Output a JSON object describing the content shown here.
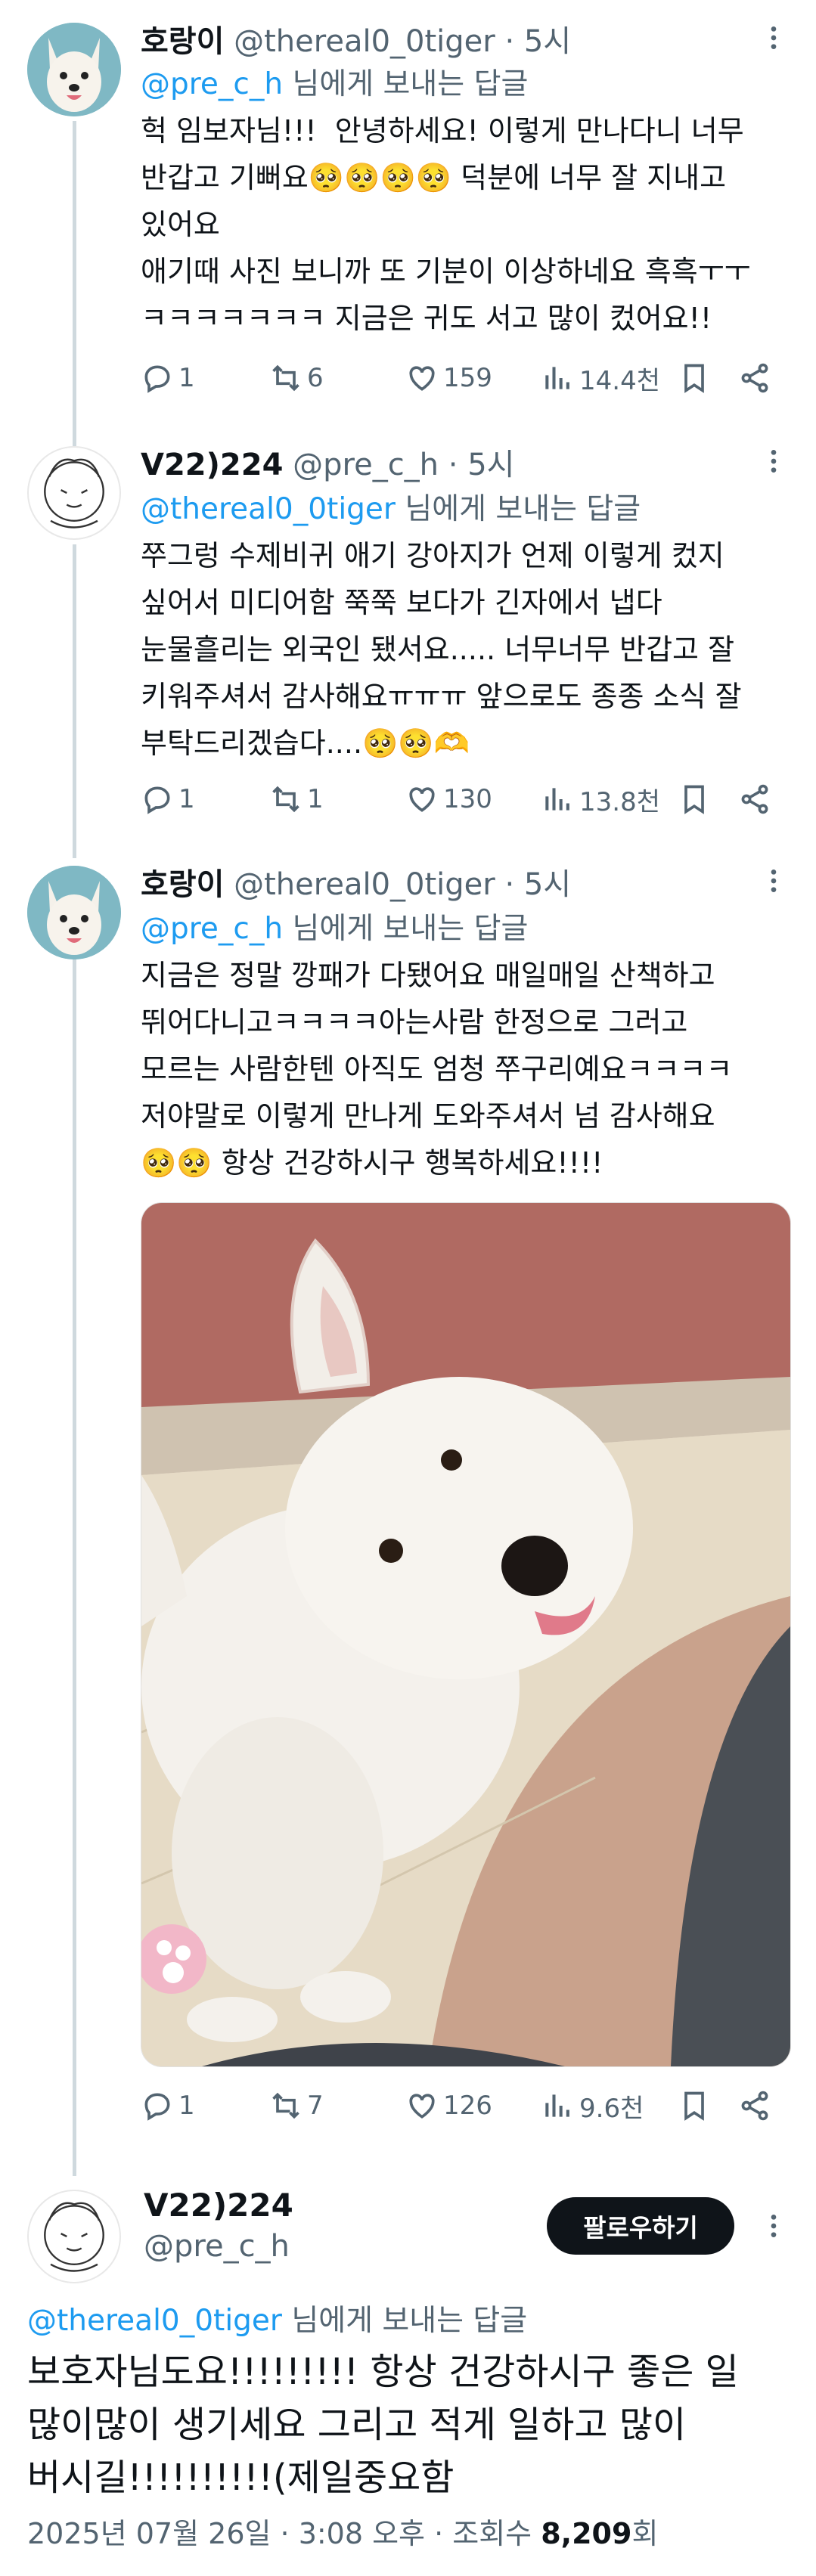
{
  "tweets": [
    {
      "name": "호랑이",
      "handle": "@thereal0_0tiger",
      "time": "· 5시",
      "reply_mention": "@pre_c_h",
      "reply_suffix": " 님에게 보내는 답글",
      "text": "헉 임보자님!!!  안녕하세요! 이렇게 만나다니 너무\n반갑고 기뻐요🥺🥺🥺🥺 덕분에 너무 잘 지내고\n있어요\n애기때 사진 보니까 또 기분이 이상하네요 흑흑ㅜㅜ\nㅋㅋㅋㅋㅋㅋㅋ 지금은 귀도 서고 많이 컸어요!!",
      "replies": "1",
      "retweets": "6",
      "likes": "159",
      "views": "14.4천"
    },
    {
      "name": "V22)224",
      "handle": "@pre_c_h",
      "time": "· 5시",
      "reply_mention": "@thereal0_0tiger",
      "reply_suffix": " 님에게 보내는 답글",
      "text": "쭈그렁 수제비귀 애기 강아지가 언제 이렇게 컸지\n싶어서 미디어함 쭉쭉 보다가 긴자에서 냅다\n눈물흘리는 외국인 됐서요..... 너무너무 반갑고 잘\n키워주셔서 감사해요ㅠㅠㅠ 앞으로도 종종 소식 잘\n부탁드리겠습다....🥺🥺🫶",
      "replies": "1",
      "retweets": "1",
      "likes": "130",
      "views": "13.8천"
    },
    {
      "name": "호랑이",
      "handle": "@thereal0_0tiger",
      "time": "· 5시",
      "reply_mention": "@pre_c_h",
      "reply_suffix": " 님에게 보내는 답글",
      "text": "지금은 정말 깡패가 다됐어요 매일매일 산책하고\n뛰어다니고ㅋㅋㅋㅋ아는사람 한정으로 그러고\n모르는 사람한텐 아직도 엄청 쭈구리예요ㅋㅋㅋㅋ\n저야말로 이렇게 만나게 도와주셔서 넘 감사해요\n🥺🥺 항상 건강하시구 행복하세요!!!!",
      "replies": "1",
      "retweets": "7",
      "likes": "126",
      "views": "9.6천"
    }
  ],
  "main": {
    "name": "V22)224",
    "handle": "@pre_c_h",
    "follow_label": "팔로우하기",
    "reply_mention": "@thereal0_0tiger",
    "reply_suffix": " 님에게 보내는 답글",
    "text": "보호자님도요!!!!!!!!! 항상 건강하시구 좋은 일\n많이많이 생기세요 그리고 적게 일하고 많이\n버시길!!!!!!!!!!(제일중요함",
    "timestamp": "2025년 07월 26일 · 3:08 오후 · 조회수 ",
    "view_count": "8,209",
    "view_suffix": "회"
  },
  "colors": {
    "link": "#1d9bf0",
    "secondary": "#536471",
    "primary_text": "#0f1419",
    "thread_line": "#cfd9de"
  },
  "icons": [
    "reply-icon",
    "retweet-icon",
    "like-icon",
    "views-icon",
    "bookmark-icon",
    "share-icon",
    "more-icon"
  ]
}
